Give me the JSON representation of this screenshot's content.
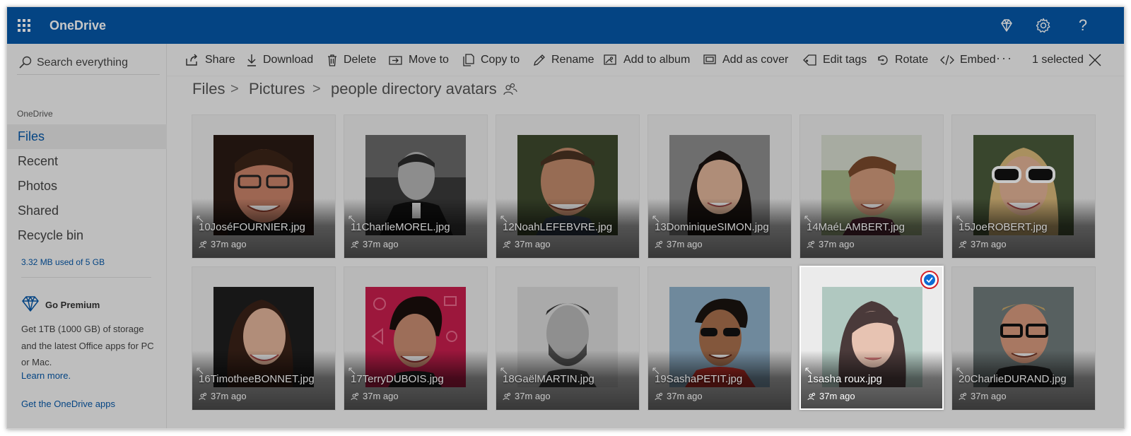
{
  "app": {
    "title": "OneDrive"
  },
  "topbar": {
    "icons": [
      "waffle-icon",
      "diamond-icon",
      "gear-icon",
      "help-icon"
    ],
    "help_glyph": "?"
  },
  "sidebar": {
    "search_placeholder": "Search everything",
    "section_title": "OneDrive",
    "nav": [
      {
        "label": "Files",
        "active": true
      },
      {
        "label": "Recent",
        "active": false
      },
      {
        "label": "Photos",
        "active": false
      },
      {
        "label": "Shared",
        "active": false
      },
      {
        "label": "Recycle bin",
        "active": false
      }
    ],
    "storage": "3.32 MB used of 5 GB",
    "premium": {
      "title": "Go Premium",
      "description": "Get 1TB (1000 GB) of storage and the latest Office apps for PC or Mac.",
      "learn_more": "Learn more."
    },
    "get_apps": "Get the OneDrive apps"
  },
  "toolbar": {
    "buttons": [
      {
        "label": "Share",
        "icon": "share-icon"
      },
      {
        "label": "Download",
        "icon": "download-icon"
      },
      {
        "label": "Delete",
        "icon": "trash-icon"
      },
      {
        "label": "Move to",
        "icon": "move-icon"
      },
      {
        "label": "Copy to",
        "icon": "copy-icon"
      },
      {
        "label": "Rename",
        "icon": "pencil-icon"
      },
      {
        "label": "Add to album",
        "icon": "album-icon"
      },
      {
        "label": "Add as cover",
        "icon": "cover-icon"
      },
      {
        "label": "Edit tags",
        "icon": "tag-icon"
      },
      {
        "label": "Rotate",
        "icon": "rotate-icon"
      },
      {
        "label": "Embed",
        "icon": "embed-icon"
      }
    ],
    "more": "···",
    "selected": "1 selected"
  },
  "breadcrumb": {
    "items": [
      "Files",
      "Pictures",
      "people directory avatars"
    ],
    "separator": ">"
  },
  "files": [
    {
      "name": "10JoséFOURNIER.jpg",
      "time": "37m ago",
      "selected": false
    },
    {
      "name": "11CharlieMOREL.jpg",
      "time": "37m ago",
      "selected": false
    },
    {
      "name": "12NoahLEFEBVRE.jpg",
      "time": "37m ago",
      "selected": false
    },
    {
      "name": "13DominiqueSIMON.jpg",
      "time": "37m ago",
      "selected": false
    },
    {
      "name": "14MaéLAMBERT.jpg",
      "time": "37m ago",
      "selected": false
    },
    {
      "name": "15JoeROBERT.jpg",
      "time": "37m ago",
      "selected": false
    },
    {
      "name": "16TimotheeBONNET.jpg",
      "time": "37m ago",
      "selected": false
    },
    {
      "name": "17TerryDUBOIS.jpg",
      "time": "37m ago",
      "selected": false
    },
    {
      "name": "18GaëlMARTIN.jpg",
      "time": "37m ago",
      "selected": false
    },
    {
      "name": "19SashaPETIT.jpg",
      "time": "37m ago",
      "selected": false
    },
    {
      "name": "1sasha roux.jpg",
      "time": "37m ago",
      "selected": true
    },
    {
      "name": "20CharlieDURAND.jpg",
      "time": "37m ago",
      "selected": false
    }
  ],
  "colors": {
    "brand": "#0658a8",
    "check": "#0b6bd4",
    "highlight_ring": "#d42027"
  }
}
